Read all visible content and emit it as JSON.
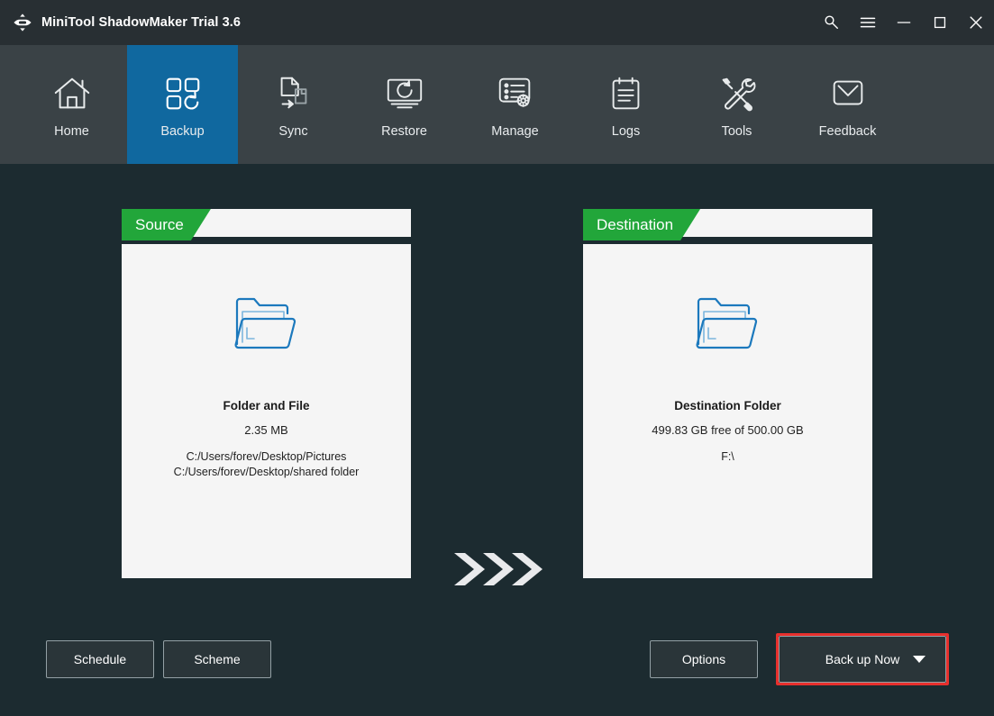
{
  "window": {
    "title": "MiniTool ShadowMaker Trial 3.6",
    "logo_icon": "move-arrows-logo-icon",
    "controls": [
      {
        "name": "key-icon",
        "label": "Register"
      },
      {
        "name": "hamburger-icon",
        "label": "Menu"
      },
      {
        "name": "minimize-icon",
        "label": "Minimize"
      },
      {
        "name": "maximize-icon",
        "label": "Maximize"
      },
      {
        "name": "close-icon",
        "label": "Close"
      }
    ]
  },
  "nav": {
    "active": "Backup",
    "items": [
      {
        "label": "Home",
        "icon": "home-icon"
      },
      {
        "label": "Backup",
        "icon": "backup-grid-icon"
      },
      {
        "label": "Sync",
        "icon": "sync-files-icon"
      },
      {
        "label": "Restore",
        "icon": "restore-monitor-icon"
      },
      {
        "label": "Manage",
        "icon": "manage-list-gear-icon"
      },
      {
        "label": "Logs",
        "icon": "logs-clipboard-icon"
      },
      {
        "label": "Tools",
        "icon": "tools-wrench-screwdriver-icon"
      },
      {
        "label": "Feedback",
        "icon": "feedback-envelope-icon"
      }
    ]
  },
  "source": {
    "tab_label": "Source",
    "icon": "folder-icon",
    "title": "Folder and File",
    "size": "2.35 MB",
    "path_line_1": "C:/Users/forev/Desktop/Pictures",
    "path_line_2": "C:/Users/forev/Desktop/shared folder"
  },
  "destination": {
    "tab_label": "Destination",
    "icon": "folder-icon",
    "title": "Destination Folder",
    "free_space": "499.83 GB free of 500.00 GB",
    "drive": "F:\\"
  },
  "transfer": {
    "icon": "triple-chevron-right-icon"
  },
  "footer": {
    "schedule": "Schedule",
    "scheme": "Scheme",
    "options": "Options",
    "backup_now": "Back up Now",
    "backup_caret": "caret-down-icon"
  },
  "colors": {
    "titlebar": "#282f33",
    "navbar": "#3a4246",
    "active_tab": "#10689f",
    "background": "#1c2b30",
    "panel": "#f5f5f5",
    "banner_green": "#22a63a",
    "folder_blue": "#1c79bd",
    "highlight_red": "#e8302d"
  }
}
